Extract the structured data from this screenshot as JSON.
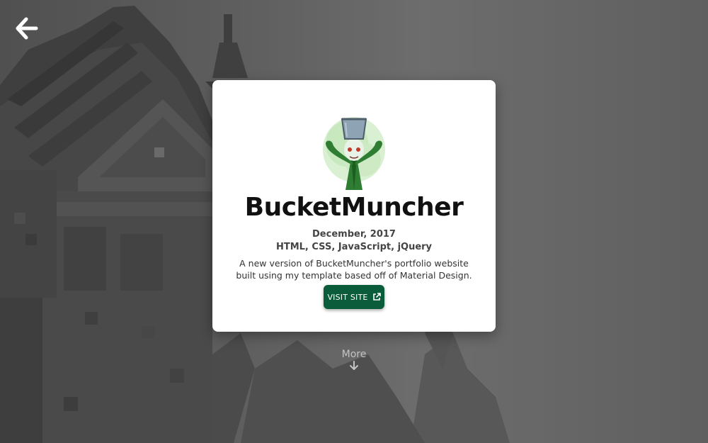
{
  "nav": {
    "back_icon": "arrow-left-icon"
  },
  "project": {
    "title": "BucketMuncher",
    "date": "December, 2017",
    "technologies": "HTML, CSS, JavaScript, jQuery",
    "description": "A new version of BucketMuncher's portfolio website built using my template based off of Material Design.",
    "visit_label": "VISIT SITE",
    "visit_icon": "external-link-icon",
    "logo_icon": "bucketmuncher-logo"
  },
  "footer": {
    "more_label": "More",
    "more_icon": "arrow-down-icon"
  },
  "colors": {
    "button": "#0a5c3a",
    "card": "#ffffff",
    "background": "#5f5f5f"
  }
}
